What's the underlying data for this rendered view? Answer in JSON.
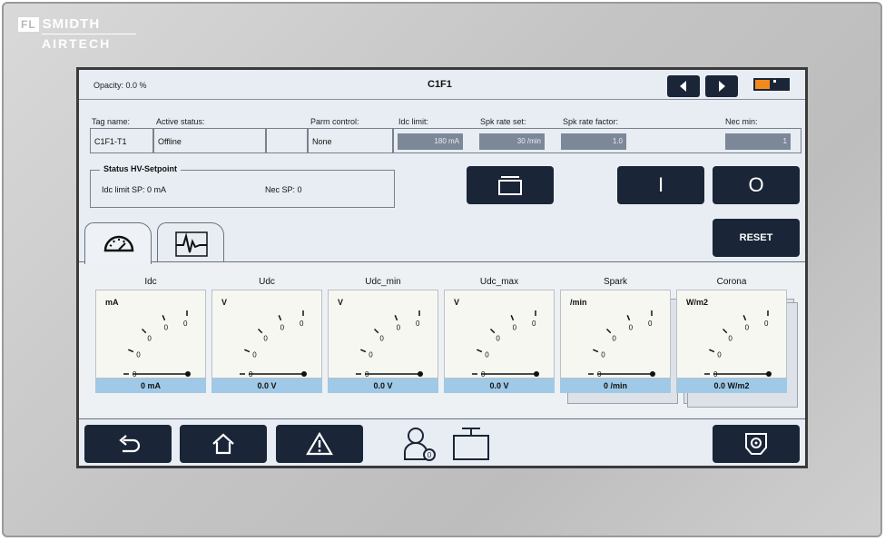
{
  "brand": {
    "line1_box": "FL",
    "line1": "SMIDTH",
    "line2": "AIRTECH"
  },
  "header": {
    "opacity_label": "Opacity: 0.0 %",
    "title": "C1F1",
    "prev_icon": "triangle-left-icon",
    "next_icon": "triangle-right-icon",
    "status_color": "#f28a1e"
  },
  "params": {
    "labels": {
      "tag": "Tag name:",
      "active": "Active status:",
      "parm": "Parm control:",
      "idc": "Idc limit:",
      "spk_set": "Spk rate set:",
      "spk_factor": "Spk rate factor:",
      "nec_min": "Nec min:"
    },
    "values": {
      "tag": "C1F1-T1",
      "active": "Offline",
      "parm": "None",
      "idc": "180 mA",
      "spk_set": "30 /min",
      "spk_factor": "1.0",
      "nec_min": "1"
    }
  },
  "status": {
    "title": "Status HV-Setpoint",
    "idc_sp": "Idc limit SP: 0 mA",
    "nec_sp": "Nec SP: 0"
  },
  "controls": {
    "on_label": "I",
    "off_label": "O",
    "reset_label": "RESET",
    "monitor_icon": "monitor-icon"
  },
  "tabs": [
    {
      "icon": "gauge-icon"
    },
    {
      "icon": "waveform-icon"
    }
  ],
  "meters": [
    {
      "name": "Idc",
      "unit": "mA",
      "value": "0 mA"
    },
    {
      "name": "Udc",
      "unit": "V",
      "value": "0.0 V"
    },
    {
      "name": "Udc_min",
      "unit": "V",
      "value": "0.0 V"
    },
    {
      "name": "Udc_max",
      "unit": "V",
      "value": "0.0 V"
    },
    {
      "name": "Spark",
      "unit": "/min",
      "value": "0 /min"
    },
    {
      "name": "Corona",
      "unit": "W/m2",
      "value": "0.0 W/m2"
    }
  ],
  "scale_tick_label": "0",
  "bottom": {
    "back_icon": "undo-arrow-icon",
    "home_icon": "home-icon",
    "alarm_icon": "warning-icon",
    "user_icon": "user-login-icon",
    "screen_icon": "monitor-icon",
    "filter_icon": "filter-settings-icon"
  }
}
